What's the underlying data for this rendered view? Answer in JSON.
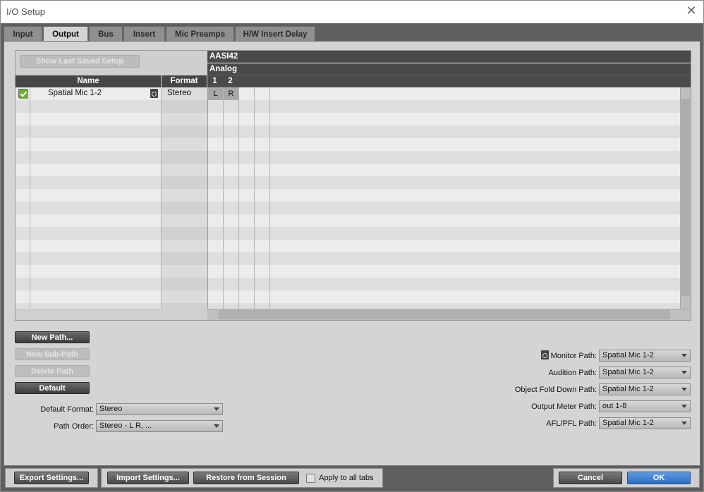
{
  "window": {
    "title": "I/O Setup",
    "close_glyph": "✕"
  },
  "tabs": [
    {
      "label": "Input"
    },
    {
      "label": "Output",
      "active": true
    },
    {
      "label": "Bus"
    },
    {
      "label": "Insert"
    },
    {
      "label": "Mic Preamps"
    },
    {
      "label": "H/W Insert Delay"
    }
  ],
  "grid": {
    "show_saved_label": "Show Last Saved Setup",
    "name_header": "Name",
    "format_header": "Format",
    "device": "AASI42",
    "io_type": "Analog",
    "channels": [
      "1",
      "2"
    ],
    "paths": [
      {
        "checked": true,
        "name": "Spatial Mic 1-2",
        "format": "Stereo",
        "assign": [
          "L",
          "R"
        ]
      }
    ]
  },
  "path_buttons": {
    "new_path": "New Path...",
    "new_sub_path": "New Sub-Path",
    "delete_path": "Delete Path",
    "default": "Default"
  },
  "left_settings": {
    "default_format_label": "Default Format:",
    "default_format_value": "Stereo",
    "path_order_label": "Path Order:",
    "path_order_value": "Stereo - L R, ..."
  },
  "right_settings": {
    "monitor_label": "Monitor Path:",
    "monitor_value": "Spatial Mic 1-2",
    "audition_label": "Audition Path:",
    "audition_value": "Spatial Mic 1-2",
    "fold_label": "Object Fold Down Path:",
    "fold_value": "Spatial Mic 1-2",
    "meter_label": "Output Meter Path:",
    "meter_value": "out 1-8",
    "afl_label": "AFL/PFL Path:",
    "afl_value": "Spatial Mic 1-2"
  },
  "bottom": {
    "export": "Export Settings...",
    "import": "Import Settings...",
    "restore": "Restore from Session",
    "apply_all": "Apply to all tabs",
    "cancel": "Cancel",
    "ok": "OK"
  },
  "colors": {
    "ok_button": "#2c6ec4",
    "grid_header": "#464646",
    "panel": "#d4d4d4"
  }
}
